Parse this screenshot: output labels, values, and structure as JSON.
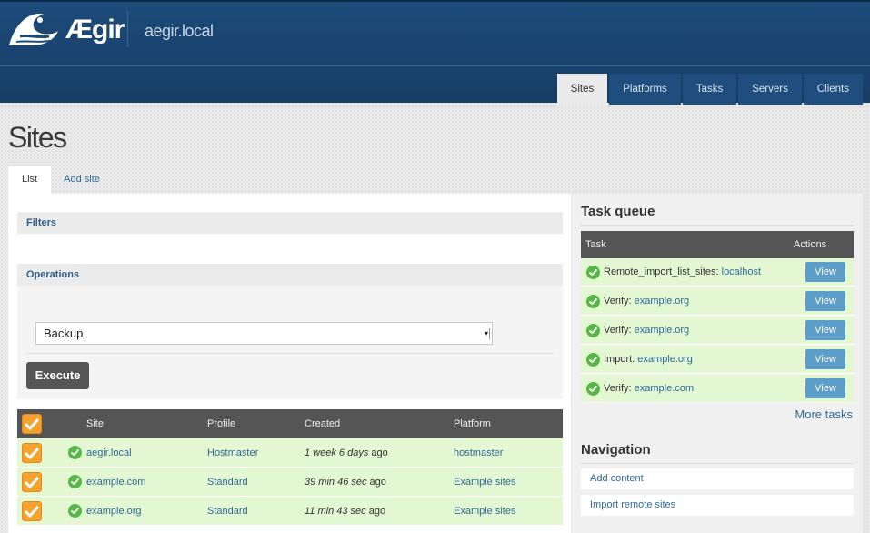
{
  "header": {
    "logo_text": "Ægir",
    "site_name": "aegir.local",
    "nav": [
      "Sites",
      "Platforms",
      "Tasks",
      "Servers",
      "Clients"
    ],
    "active_nav": "Sites"
  },
  "page": {
    "title": "Sites",
    "tabs": [
      "List",
      "Add site"
    ]
  },
  "filters": {
    "label": "Filters"
  },
  "operations": {
    "label": "Operations",
    "selected": "Backup",
    "execute_label": "Execute"
  },
  "sites_table": {
    "columns": [
      "Site",
      "Profile",
      "Created",
      "Platform"
    ],
    "rows": [
      {
        "site": "aegir.local",
        "profile": "Hostmaster",
        "created_em": "1 week 6 days",
        "created_suffix": " ago",
        "platform": "hostmaster"
      },
      {
        "site": "example.com",
        "profile": "Standard",
        "created_em": "39 min 46 sec",
        "created_suffix": " ago",
        "platform": "Example sites"
      },
      {
        "site": "example.org",
        "profile": "Standard",
        "created_em": "11 min 43 sec",
        "created_suffix": " ago",
        "platform": "Example sites"
      }
    ]
  },
  "task_queue": {
    "title": "Task queue",
    "columns": [
      "Task",
      "Actions"
    ],
    "rows": [
      {
        "label": "Remote_import_list_sites:",
        "target": "localhost",
        "action": "View"
      },
      {
        "label": "Verify:",
        "target": "example.org",
        "action": "View"
      },
      {
        "label": "Verify:",
        "target": "example.org",
        "action": "View"
      },
      {
        "label": "Import:",
        "target": "example.org",
        "action": "View"
      },
      {
        "label": "Verify:",
        "target": "example.com",
        "action": "View"
      }
    ],
    "more_label": "More tasks"
  },
  "navigation": {
    "title": "Navigation",
    "items": [
      "Add content",
      "Import remote sites"
    ]
  },
  "colors": {
    "header_bg": "#1d4b7a",
    "row_success": "#e2f7d2",
    "checkbox": "#f7a12f",
    "view_button": "#5d9ec9",
    "execute_button": "#555555"
  }
}
